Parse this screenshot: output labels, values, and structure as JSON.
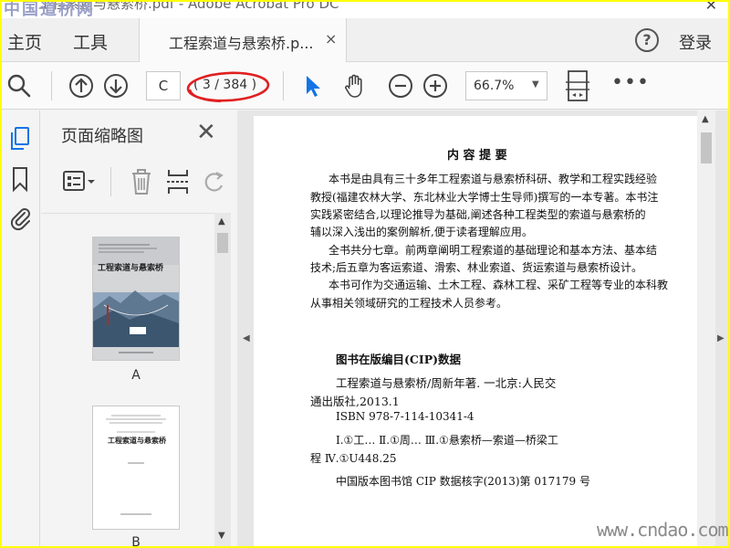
{
  "window": {
    "watermark_top": "中国道桥网",
    "title": "工程索道与悬索桥.pdf - Adobe Acrobat Pro DC"
  },
  "menu": {
    "home": "主页",
    "tools": "工具",
    "doc_tab": "工程索道与悬索桥.p...",
    "doc_tab_close": "×",
    "help": "?",
    "login": "登录"
  },
  "toolbar": {
    "page_input": "C",
    "page_count": "( 3 / 384 )",
    "zoom": "66.7%",
    "more": "•••"
  },
  "thumbnails": {
    "title": "页面缩略图",
    "close": "✕",
    "items": [
      {
        "label": "A",
        "cover_title": "工程索道与悬索桥"
      },
      {
        "label": "B",
        "cover_title": "工程索道与悬索桥"
      }
    ]
  },
  "page": {
    "heading": "内 容 提 要",
    "summary": [
      "本书是由具有三十多年工程索道与悬索桥科研、教学和工程实践经验",
      "教授(福建农林大学、东北林业大学博士生导师)撰写的一本专著。本书注",
      "实践紧密结合,以理论推导为基础,阐述各种工程类型的索道与悬索桥的",
      "辅以深入浅出的案例解析,便于读者理解应用。",
      "全书共分七章。前两章阐明工程索道的基础理论和基本方法、基本结",
      "技术;后五章为客运索道、滑索、林业索道、货运索道与悬索桥设计。",
      "本书可作为交通运输、土木工程、森林工程、采矿工程等专业的本科教",
      "从事相关领域研究的工程技术人员参考。"
    ],
    "cip_heading": "图书在版编目(CIP)数据",
    "cip_lines": [
      "工程索道与悬索桥/周新年著. 一北京:人民交",
      "通出版社,2013.1",
      "ISBN  978-7-114-10341-4",
      "Ⅰ.①工…  Ⅱ.①周…  Ⅲ.①悬索桥—索道—桥梁工",
      "程  Ⅳ.①U448.25",
      "中国版本图书馆 CIP 数据核字(2013)第 017179 号"
    ]
  },
  "watermark_bottom": "www.cndao.com",
  "colors": {
    "outer_border": "#ffff00",
    "annotation": "#e02020",
    "select_tool": "#1473e6"
  }
}
